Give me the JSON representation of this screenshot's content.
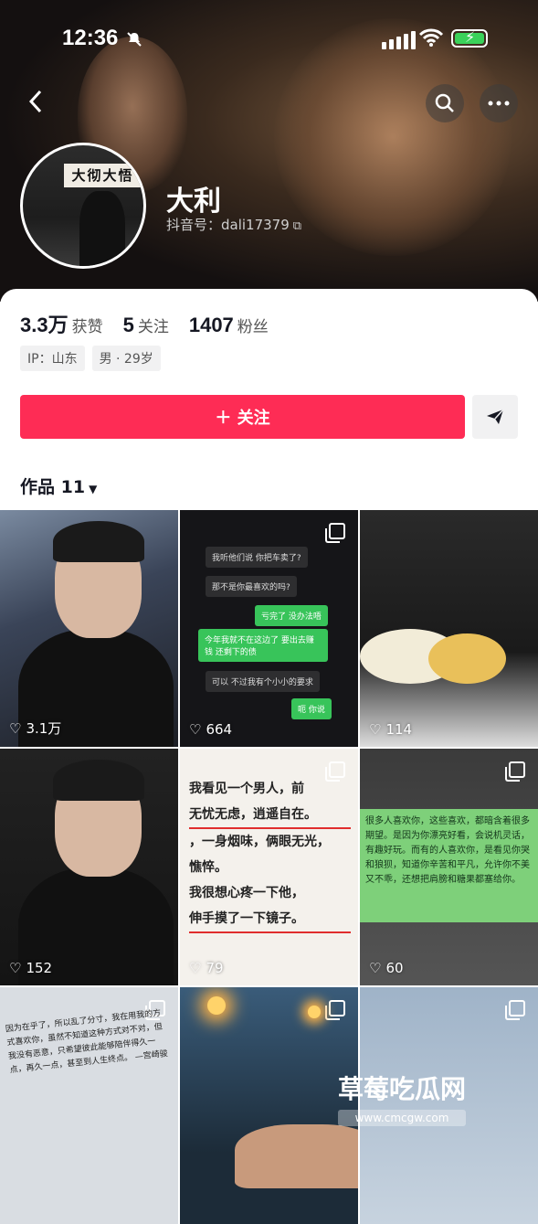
{
  "status_bar": {
    "time": "12:36"
  },
  "profile": {
    "nickname": "大利",
    "douyin_id": "抖音号：dali17379",
    "avatar_sign": "大彻大悟"
  },
  "stats": [
    {
      "value": "3.3万",
      "label": "获赞"
    },
    {
      "value": "5",
      "label": "关注"
    },
    {
      "value": "1407",
      "label": "粉丝"
    }
  ],
  "tags": [
    "IP：山东",
    "男 · 29岁"
  ],
  "follow_button": "＋ 关注",
  "works_label": "作品 11",
  "grid": [
    {
      "likes": "3.1万"
    },
    {
      "likes": "664",
      "chats": [
        "我听他们说 你把车卖了?",
        "那不是你最喜欢的吗?",
        "亏完了 没办法唔",
        "今年我就不在这边了 要出去赚钱 还剩下的债",
        "可以 不过我有个小小的要求",
        "呃 你说"
      ]
    },
    {
      "likes": "114"
    },
    {
      "likes": "152"
    },
    {
      "likes": "79",
      "note": [
        "我看见一个男人，前",
        "无忧无虑，逍遥自在。",
        "，一身烟味，俩眼无光，",
        "憔悴。",
        "我很想心疼一下他，",
        "伸手摸了一下镜子。"
      ]
    },
    {
      "likes": "60",
      "text": "很多人喜欢你，这些喜欢，都暗含着很多期望。是因为你漂亮好看，会说机灵话，有趣好玩。而有的人喜欢你，是看见你哭和狼狈，知道你辛苦和平凡，允许你不美又不乖，还想把肩膀和糖果都塞给你。"
    },
    {
      "likes": "",
      "text": "因为在乎了，所以乱了分寸，我在用我的方式喜欢你，虽然不知道这种方式对不对，但我没有恶意，只希望彼此能够陪伴得久一点，再久一点，甚至到人生终点。 —宫崎骏"
    },
    {
      "likes": ""
    },
    {
      "likes": ""
    }
  ],
  "watermark": {
    "title": "草莓吃瓜网",
    "url": "www.cmcgw.com"
  }
}
